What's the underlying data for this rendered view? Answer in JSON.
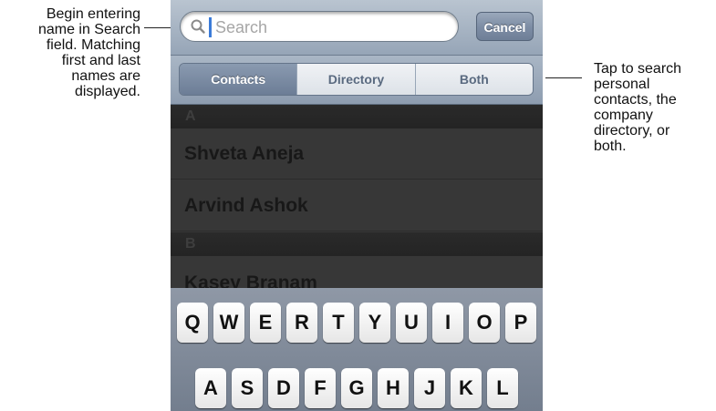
{
  "callouts": {
    "left": [
      "Begin entering",
      "name in Search",
      "field. Matching",
      "first and last",
      "names are",
      "displayed."
    ],
    "right": [
      "Tap to search",
      "personal",
      "contacts, the",
      "company",
      "directory, or",
      "both."
    ]
  },
  "search": {
    "value": "",
    "placeholder": "Search",
    "cancel_label": "Cancel"
  },
  "scope": {
    "segments": [
      "Contacts",
      "Directory",
      "Both"
    ],
    "selected": "Contacts"
  },
  "list": {
    "section_a": "A",
    "contacts_a": [
      "Shveta Aneja",
      "Arvind Ashok"
    ],
    "section_b": "B",
    "contacts_b": [
      "Kasey Branam"
    ]
  },
  "keyboard": {
    "row1": [
      "Q",
      "W",
      "E",
      "R",
      "T",
      "Y",
      "U",
      "I",
      "O",
      "P"
    ],
    "row2": [
      "A",
      "S",
      "D",
      "F",
      "G",
      "H",
      "J",
      "K",
      "L"
    ]
  },
  "colors": {
    "accent": "#6c7d96",
    "cursor": "#3b7bd8"
  }
}
